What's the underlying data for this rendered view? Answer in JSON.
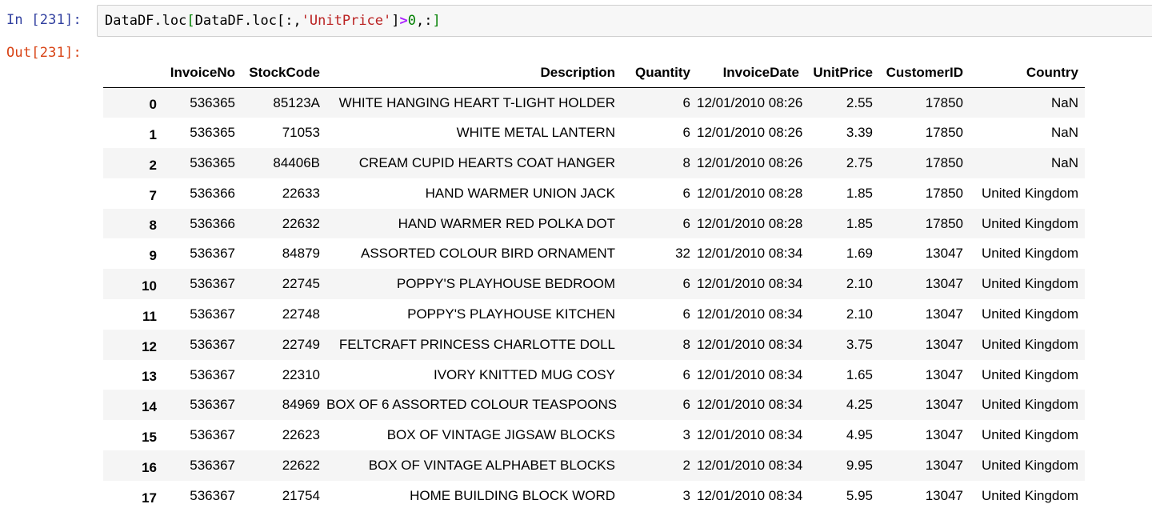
{
  "cell": {
    "in_prompt": "In [231]:",
    "out_prompt": "Out[231]:",
    "code": {
      "t1": "DataDF.loc",
      "t2": "[",
      "t3": "DataDF.loc[:,",
      "t4": "'UnitPrice'",
      "t5": "]",
      "t6": ">",
      "t7": "0",
      "t8": ",:",
      "t9": "]"
    }
  },
  "table": {
    "columns": [
      "",
      "InvoiceNo",
      "StockCode",
      "Description",
      "Quantity",
      "InvoiceDate",
      "UnitPrice",
      "CustomerID",
      "Country"
    ],
    "rows": [
      [
        "0",
        "536365",
        "85123A",
        "WHITE HANGING HEART T-LIGHT HOLDER",
        "6",
        "12/01/2010 08:26",
        "2.55",
        "17850",
        "NaN"
      ],
      [
        "1",
        "536365",
        "71053",
        "WHITE METAL LANTERN",
        "6",
        "12/01/2010 08:26",
        "3.39",
        "17850",
        "NaN"
      ],
      [
        "2",
        "536365",
        "84406B",
        "CREAM CUPID HEARTS COAT HANGER",
        "8",
        "12/01/2010 08:26",
        "2.75",
        "17850",
        "NaN"
      ],
      [
        "7",
        "536366",
        "22633",
        "HAND WARMER UNION JACK",
        "6",
        "12/01/2010 08:28",
        "1.85",
        "17850",
        "United Kingdom"
      ],
      [
        "8",
        "536366",
        "22632",
        "HAND WARMER RED POLKA DOT",
        "6",
        "12/01/2010 08:28",
        "1.85",
        "17850",
        "United Kingdom"
      ],
      [
        "9",
        "536367",
        "84879",
        "ASSORTED COLOUR BIRD ORNAMENT",
        "32",
        "12/01/2010 08:34",
        "1.69",
        "13047",
        "United Kingdom"
      ],
      [
        "10",
        "536367",
        "22745",
        "POPPY'S PLAYHOUSE BEDROOM",
        "6",
        "12/01/2010 08:34",
        "2.10",
        "13047",
        "United Kingdom"
      ],
      [
        "11",
        "536367",
        "22748",
        "POPPY'S PLAYHOUSE KITCHEN",
        "6",
        "12/01/2010 08:34",
        "2.10",
        "13047",
        "United Kingdom"
      ],
      [
        "12",
        "536367",
        "22749",
        "FELTCRAFT PRINCESS CHARLOTTE DOLL",
        "8",
        "12/01/2010 08:34",
        "3.75",
        "13047",
        "United Kingdom"
      ],
      [
        "13",
        "536367",
        "22310",
        "IVORY KNITTED MUG COSY",
        "6",
        "12/01/2010 08:34",
        "1.65",
        "13047",
        "United Kingdom"
      ],
      [
        "14",
        "536367",
        "84969",
        "BOX OF 6 ASSORTED COLOUR TEASPOONS",
        "6",
        "12/01/2010 08:34",
        "4.25",
        "13047",
        "United Kingdom"
      ],
      [
        "15",
        "536367",
        "22623",
        "BOX OF VINTAGE JIGSAW BLOCKS",
        "3",
        "12/01/2010 08:34",
        "4.95",
        "13047",
        "United Kingdom"
      ],
      [
        "16",
        "536367",
        "22622",
        "BOX OF VINTAGE ALPHABET BLOCKS",
        "2",
        "12/01/2010 08:34",
        "9.95",
        "13047",
        "United Kingdom"
      ],
      [
        "17",
        "536367",
        "21754",
        "HOME BUILDING BLOCK WORD",
        "3",
        "12/01/2010 08:34",
        "5.95",
        "13047",
        "United Kingdom"
      ]
    ]
  },
  "colors": {
    "in_prompt": "#303f9f",
    "out_prompt": "#d84315",
    "string": "#ba2121",
    "operator": "#aa22ff",
    "number": "#008000",
    "row_stripe": "#f5f5f5"
  }
}
